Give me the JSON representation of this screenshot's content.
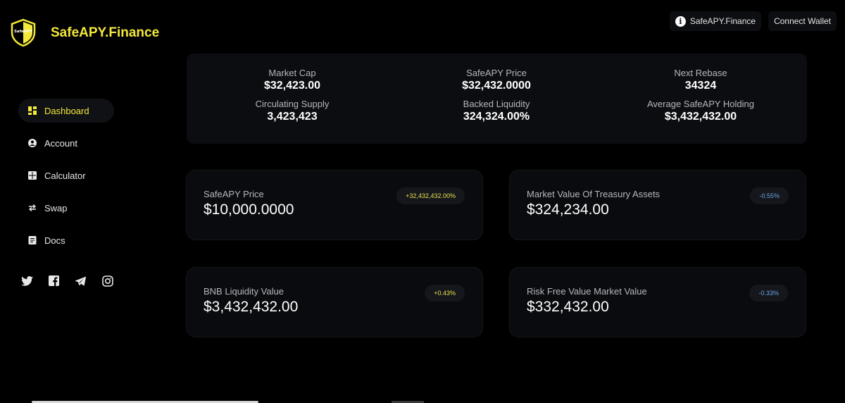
{
  "brand": {
    "name": "SafeAPY.Finance",
    "badge_text": "SafeAPY",
    "accent": "#f4e83a"
  },
  "topbar": {
    "site_label": "SafeAPY.Finance",
    "connect_label": "Connect Wallet"
  },
  "nav": [
    {
      "label": "Dashboard",
      "icon": "dashboard-icon",
      "active": true
    },
    {
      "label": "Account",
      "icon": "account-icon",
      "active": false
    },
    {
      "label": "Calculator",
      "icon": "calculator-icon",
      "active": false
    },
    {
      "label": "Swap",
      "icon": "swap-icon",
      "active": false
    },
    {
      "label": "Docs",
      "icon": "docs-icon",
      "active": false
    }
  ],
  "social": [
    "twitter-icon",
    "facebook-icon",
    "telegram-icon",
    "instagram-icon"
  ],
  "stats": [
    {
      "label": "Market Cap",
      "value": "$32,423.00"
    },
    {
      "label": "SafeAPY Price",
      "value": "$32,432.0000"
    },
    {
      "label": "Next Rebase",
      "value": "34324"
    },
    {
      "label": "Circulating Supply",
      "value": "3,423,423"
    },
    {
      "label": "Backed Liquidity",
      "value": "324,324.00%"
    },
    {
      "label": "Average SafeAPY Holding",
      "value": "$3,432,432.00"
    }
  ],
  "cards": [
    {
      "label": "SafeAPY Price",
      "value": "$10,000.0000",
      "change": "+32,432,432.00%",
      "trend": "positive"
    },
    {
      "label": "Market Value Of Treasury Assets",
      "value": "$324,234.00",
      "change": "-0.55%",
      "trend": "negative"
    },
    {
      "label": "BNB Liquidity Value",
      "value": "$3,432,432.00",
      "change": "+0.43%",
      "trend": "positive"
    },
    {
      "label": "Risk Free Value Market Value",
      "value": "$332,432.00",
      "change": "-0.33%",
      "trend": "negative"
    }
  ]
}
